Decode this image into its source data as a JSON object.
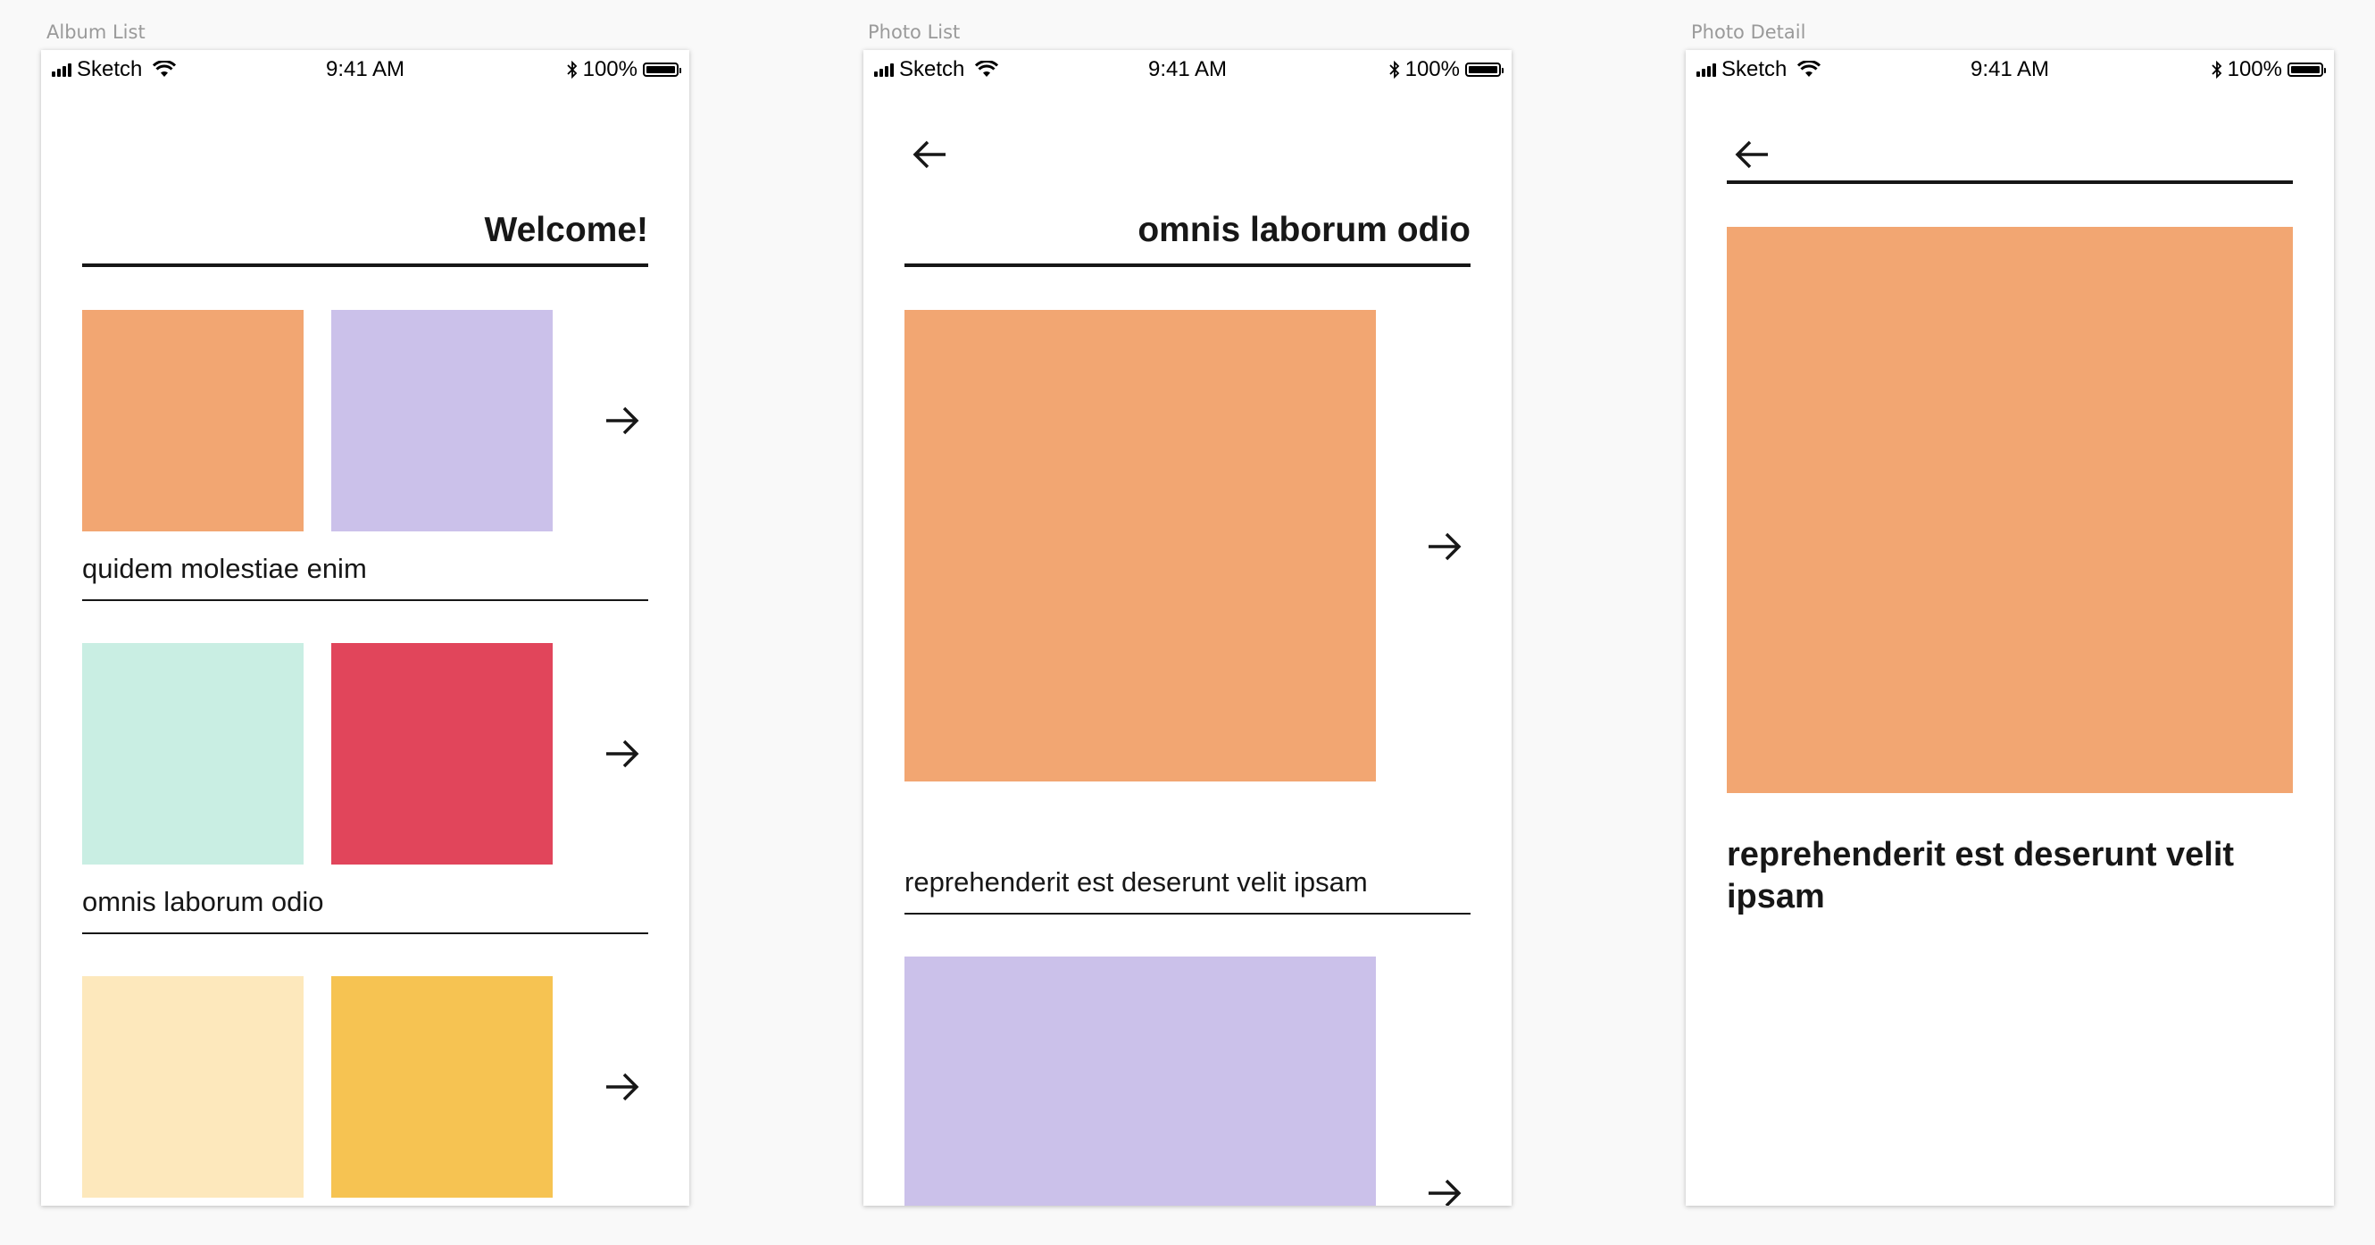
{
  "artboards": {
    "album_list": "Album List",
    "photo_list": "Photo List",
    "photo_detail": "Photo Detail"
  },
  "status_bar": {
    "carrier": "Sketch",
    "time": "9:41 AM",
    "battery": "100%"
  },
  "album_list": {
    "title": "Welcome!",
    "albums": [
      {
        "name": "quidem molestiae enim",
        "colors": [
          "#f2a672",
          "#cbc1ea"
        ]
      },
      {
        "name": "omnis laborum odio",
        "colors": [
          "#c9eee3",
          "#e1455b"
        ]
      },
      {
        "name": "",
        "colors": [
          "#fde8bc",
          "#f6c352"
        ]
      }
    ]
  },
  "photo_list": {
    "title": "omnis laborum odio",
    "photos": [
      {
        "caption": "reprehenderit est deserunt velit ipsam",
        "color": "#f2a672"
      },
      {
        "caption": "",
        "color": "#cbc1ea"
      }
    ]
  },
  "photo_detail": {
    "title": "reprehenderit est deserunt velit ipsam",
    "color": "#f2a672"
  },
  "icons": {
    "forward": "arrow-right-icon",
    "back": "arrow-left-icon"
  }
}
